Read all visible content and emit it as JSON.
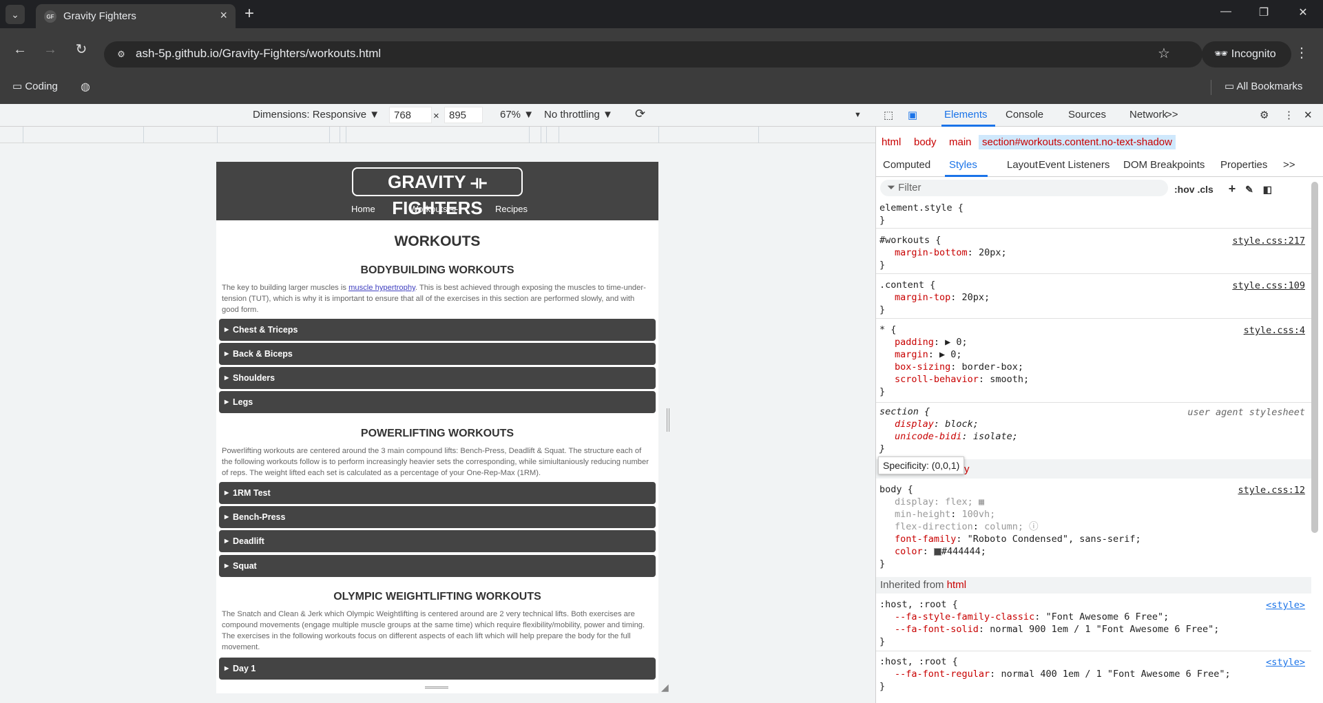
{
  "browser": {
    "tab_title": "Gravity Fighters",
    "url": "ash-5p.github.io/Gravity-Fighters/workouts.html",
    "incognito_label": "Incognito",
    "bookmarks": {
      "coding": "Coding",
      "all": "All Bookmarks"
    }
  },
  "device_toolbar": {
    "dimensions": "Dimensions: Responsive ▼",
    "width": "768",
    "height": "895",
    "times": "×",
    "zoom": "67% ▼",
    "throttling": "No throttling ▼"
  },
  "site": {
    "logo": "GRAVITY ⟛ FIGHTERS",
    "nav": [
      "Home",
      "Workouts ⟛",
      "Recipes"
    ],
    "title": "WORKOUTS",
    "sections": [
      {
        "heading": "BODYBUILDING WORKOUTS",
        "text_before": "The key to building larger muscles is ",
        "link": "muscle hypertrophy",
        "text_after": ". This is best achieved through exposing the muscles to time-under-tension (TUT), which is why it is important to ensure that all of the exercises in this section are performed slowly, and with good form.",
        "items": [
          "Chest & Triceps",
          "Back & Biceps",
          "Shoulders",
          "Legs"
        ]
      },
      {
        "heading": "POWERLIFTING WORKOUTS",
        "text": "Powerlifting workouts are centered around the 3 main compound lifts: Bench-Press, Deadlift & Squat. The structure each of the following workouts follow is to perform increasingly heavier sets the corresponding, while simiultaniously reducing number of reps. The weight lifted each set is calculated as a percentage of your One-Rep-Max (1RM).",
        "items": [
          "1RM Test",
          "Bench-Press",
          "Deadlift",
          "Squat"
        ]
      },
      {
        "heading": "OLYMPIC WEIGHTLIFTING WORKOUTS",
        "text": "The Snatch and Clean & Jerk which Olympic Weightlifting is centered around are 2 very technical lifts. Both exercises are compound movements (engage multiple muscle groups at the same time) which require flexibility/mobility, power and timing. The exercises in the following workouts focus on different aspects of each lift which will help prepare the body for the full movement.",
        "items": [
          "Day 1"
        ]
      }
    ]
  },
  "devtools": {
    "tabs": [
      "Elements",
      "Console",
      "Sources",
      "Network",
      ">>"
    ],
    "breadcrumbs": [
      "html",
      "body",
      "main",
      "section#workouts.content.no-text-shadow"
    ],
    "subtabs": [
      "Computed",
      "Styles",
      "Layout",
      "Event Listeners",
      "DOM Breakpoints",
      "Properties",
      ">>"
    ],
    "filter_placeholder": "Filter",
    "filter_tools": ":hov  .cls",
    "rules": [
      {
        "selector": "element.style {",
        "lines": [],
        "close": "}",
        "source": ""
      },
      {
        "selector": "#workouts {",
        "lines": [
          {
            "p": "margin-bottom",
            "v": "20px;"
          }
        ],
        "close": "}",
        "source": "style.css:217"
      },
      {
        "selector": ".content {",
        "lines": [
          {
            "p": "margin-top",
            "v": "20px;"
          }
        ],
        "close": "}",
        "source": "style.css:109"
      },
      {
        "selector": "* {",
        "lines": [
          {
            "p": "padding",
            "v": "▶ 0;"
          },
          {
            "p": "margin",
            "v": "▶ 0;"
          },
          {
            "p": "box-sizing",
            "v": "border-box;"
          },
          {
            "p": "scroll-behavior",
            "v": "smooth;"
          }
        ],
        "close": "}",
        "source": "style.css:4"
      },
      {
        "selector": "section {",
        "lines": [
          {
            "p": "display",
            "v": "block;"
          },
          {
            "p": "unicode-bidi",
            "v": "isolate;"
          }
        ],
        "close": "}",
        "source": "user agent stylesheet"
      },
      {
        "selector": "body {",
        "lines": [
          {
            "p": "display",
            "v": "flex;"
          },
          {
            "p": "min-height",
            "v": "100vh;"
          },
          {
            "p": "flex-direction",
            "v": "column;"
          },
          {
            "p": "font-family",
            "v": "\"Roboto Condensed\", sans-serif;"
          },
          {
            "p": "color",
            "v": "#444444;"
          }
        ],
        "close": "}",
        "source": "style.css:12"
      }
    ],
    "tooltip": "Specificity: (0,0,1)",
    "tooltip_tail": "y",
    "inherited_label": "Inherited from",
    "inherited_from": "html",
    "inherited_rules": [
      {
        "selector": ":host, :root {",
        "lines": [
          {
            "p": "--fa-style-family-classic",
            "v": "\"Font Awesome 6 Free\";"
          },
          {
            "p": "--fa-font-solid",
            "v": "normal 900 1em / 1 \"Font Awesome 6 Free\";"
          }
        ],
        "close": "}",
        "source": "<style>"
      },
      {
        "selector": ":host, :root {",
        "lines": [
          {
            "p": "--fa-font-regular",
            "v": "normal 400 1em / 1 \"Font Awesome 6 Free\";"
          }
        ],
        "close": "}",
        "source": "<style>"
      }
    ]
  }
}
